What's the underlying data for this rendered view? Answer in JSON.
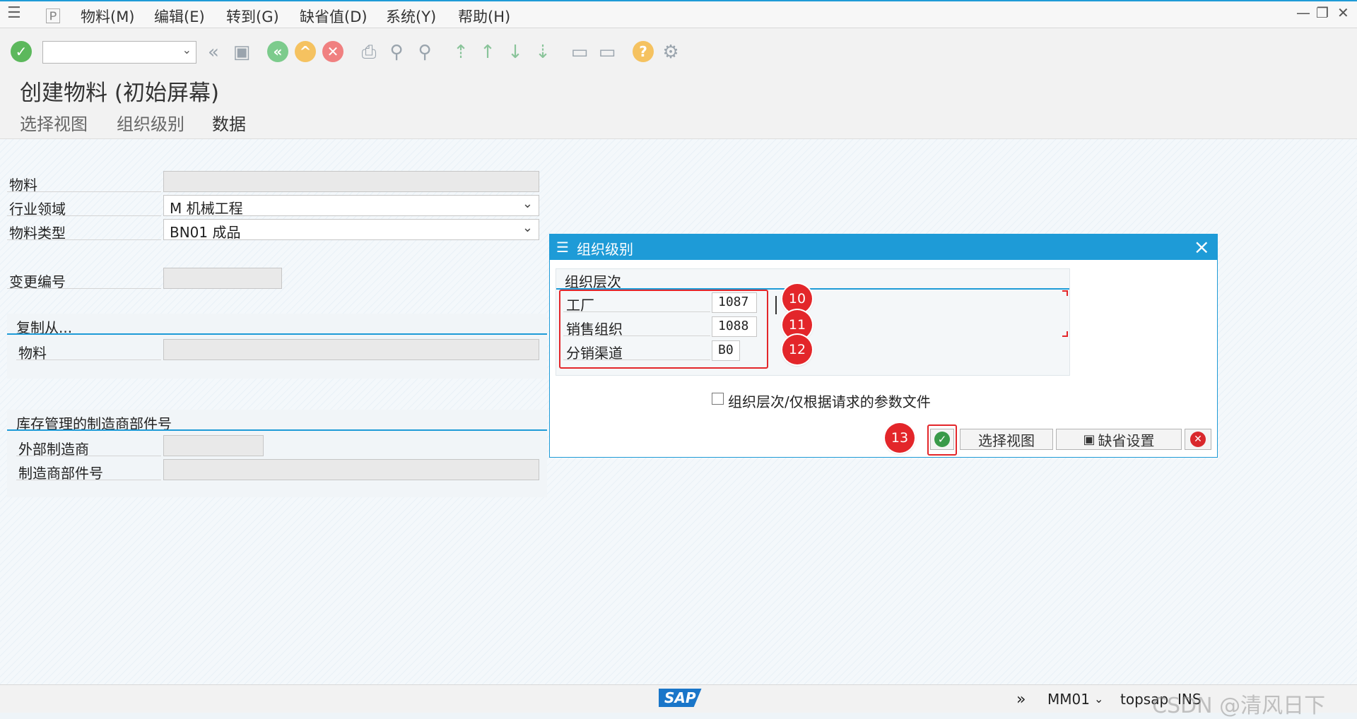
{
  "menubar": {
    "items": [
      "物料(M)",
      "编辑(E)",
      "转到(G)",
      "缺省值(D)",
      "系统(Y)",
      "帮助(H)"
    ]
  },
  "toolbar": {
    "icons": [
      "enter-icon",
      "back-icon",
      "save-icon",
      "back-green-icon",
      "exit-icon",
      "cancel-icon",
      "print-icon",
      "find-icon",
      "find-next-icon",
      "first-page-icon",
      "prev-page-icon",
      "next-page-icon",
      "last-page-icon",
      "new-session-icon",
      "shortcut-icon",
      "help-icon",
      "settings-icon"
    ]
  },
  "title": "创建物料 (初始屏幕)",
  "appbar": {
    "items": [
      "选择视图",
      "组织级别",
      "数据"
    ]
  },
  "form": {
    "material_label": "物料",
    "industry_label": "行业领域",
    "industry_value": "M 机械工程",
    "mattype_label": "物料类型",
    "mattype_value": "BN01 成品",
    "change_label": "变更编号",
    "copy_group_title": "复制从...",
    "copy_material_label": "物料",
    "mpn_group_title": "库存管理的制造商部件号",
    "ext_mfr_label": "外部制造商",
    "mfr_part_label": "制造商部件号"
  },
  "dialog": {
    "title": "组织级别",
    "section_title": "组织层次",
    "plant_label": "工厂",
    "plant_value": "1087",
    "salesorg_label": "销售组织",
    "salesorg_value": "1088",
    "channel_label": "分销渠道",
    "channel_value": "B0",
    "checkbox_label": "组织层次/仅根据请求的参数文件",
    "btn_select_views": "选择视图",
    "btn_default_settings": "缺省设置"
  },
  "annotations": [
    "10",
    "11",
    "12",
    "13"
  ],
  "statusbar": {
    "logo": "SAP",
    "tcode": "MM01",
    "server": "topsap",
    "mode": "INS",
    "watermark": "CSDN @清风日下"
  },
  "colors": {
    "accent": "#1e9bd7",
    "highlight": "#e3262a"
  }
}
